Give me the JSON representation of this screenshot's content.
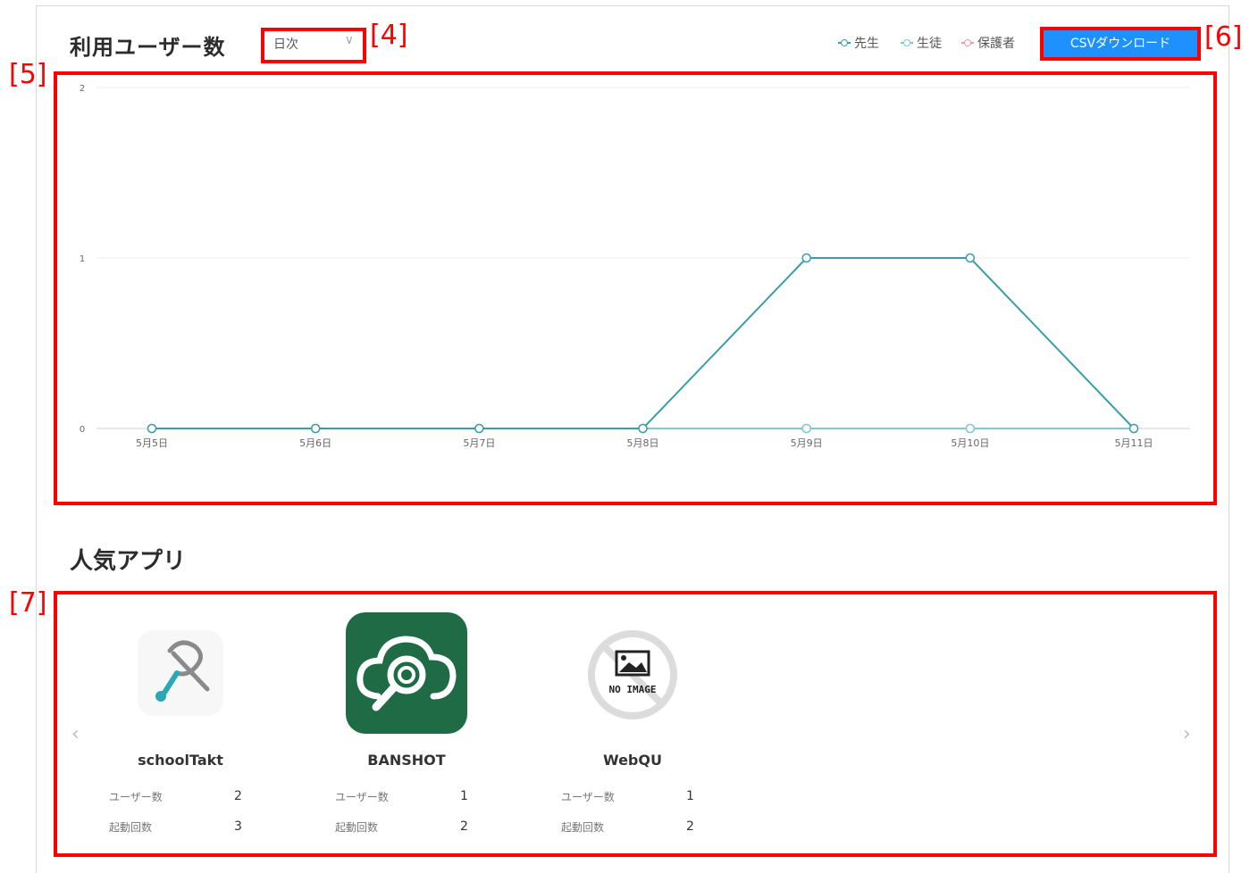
{
  "header": {
    "title": "利用ユーザー数",
    "period_select": {
      "value": "日次",
      "chevron_icon": "chevron-down-icon"
    },
    "legend": [
      {
        "label": "先生",
        "color": "#3a9ea8"
      },
      {
        "label": "生徒",
        "color": "#7ec8d8"
      },
      {
        "label": "保護者",
        "color": "#e89aa0"
      }
    ],
    "csv_button": "CSVダウンロード"
  },
  "callouts": {
    "c4": "[4]",
    "c5": "[5]",
    "c6": "[6]",
    "c7": "[7]"
  },
  "chart_data": {
    "type": "line",
    "categories": [
      "5月5日",
      "5月6日",
      "5月7日",
      "5月8日",
      "5月9日",
      "5月10日",
      "5月11日"
    ],
    "y_ticks": [
      "0",
      "1",
      "2"
    ],
    "ylim": [
      0,
      2
    ],
    "grid": true,
    "series": [
      {
        "name": "先生",
        "color": "#3a9ea8",
        "values": [
          0,
          0,
          0,
          0,
          1,
          1,
          0
        ]
      },
      {
        "name": "生徒",
        "color": "#7ec8d8",
        "values": [
          0,
          0,
          0,
          0,
          0,
          0,
          0
        ]
      },
      {
        "name": "保護者",
        "color": "#e89aa0",
        "values": [
          0,
          0,
          0,
          0,
          0,
          0,
          0
        ]
      }
    ]
  },
  "popular_apps": {
    "title": "人気アプリ",
    "prev_icon": "chevron-left-icon",
    "next_icon": "chevron-right-icon",
    "apps": [
      {
        "name": "schoolTakt",
        "icon": "schooltakt-logo-icon",
        "users_label": "ユーザー数",
        "users": "2",
        "launches_label": "起動回数",
        "launches": "3"
      },
      {
        "name": "BANSHOT",
        "icon": "banshot-logo-icon",
        "users_label": "ユーザー数",
        "users": "1",
        "launches_label": "起動回数",
        "launches": "2"
      },
      {
        "name": "WebQU",
        "icon": "no-image-icon",
        "no_image_text": "NO IMAGE",
        "users_label": "ユーザー数",
        "users": "1",
        "launches_label": "起動回数",
        "launches": "2"
      }
    ]
  }
}
